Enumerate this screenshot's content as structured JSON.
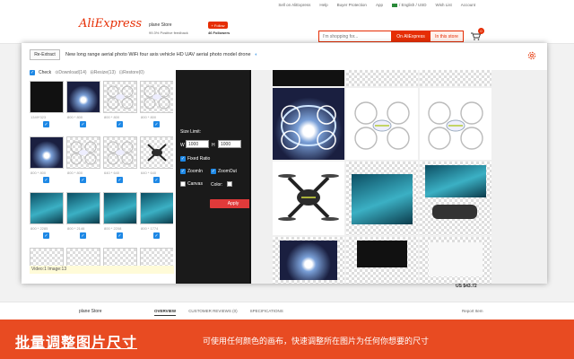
{
  "topbar": {
    "items": [
      "Sell on AliExpress",
      "Help",
      "Buyer Protection",
      "App",
      "/ English / USD",
      "Wish List",
      "Account"
    ]
  },
  "header": {
    "logo": "AliExpress",
    "store_name": "plane Store",
    "feedback": "99.3% Positive feedback",
    "follow_label": "+ Follow",
    "followers": "46 Followers",
    "search_placeholder": "I'm shopping for...",
    "search_on_ae": "On AliExpress",
    "search_in_store": "In this store",
    "cart_count": "0"
  },
  "page": {
    "price": "US $43.72",
    "store_tab": "plane Store",
    "tabs": [
      "OVERVIEW",
      "CUSTOMER REVIEWS (0)",
      "SPECIFICATIONS"
    ],
    "report_item": "Report Item"
  },
  "panel": {
    "re_extract": "Re-Extract",
    "title": "New long range aerial photo WiFi four axis vehicle HD UAV aerial photo model drone",
    "check_label": "Check",
    "download_label": "Download(14)",
    "resize_label": "Resize(13)",
    "restore_label": "Restore(0)",
    "footer_info": "Video:1 Image:13",
    "thumbs": [
      {
        "size": "1349*323",
        "style": "dark"
      },
      {
        "size": "800 * 800",
        "style": "night"
      },
      {
        "size": "800 * 800",
        "style": "drone-white"
      },
      {
        "size": "800 * 800",
        "style": "drone-white"
      },
      {
        "size": "800 * 800",
        "style": "night"
      },
      {
        "size": "800 * 800",
        "style": "drone-white"
      },
      {
        "size": "640 * 640",
        "style": "drone-white"
      },
      {
        "size": "640 * 640",
        "style": "drone-black"
      },
      {
        "size": "800 * 2285",
        "style": "teal"
      },
      {
        "size": "800 * 2146",
        "style": "teal"
      },
      {
        "size": "800 * 2208",
        "style": "teal"
      },
      {
        "size": "800 * 1774",
        "style": "teal"
      },
      {
        "size": "",
        "style": "checker"
      },
      {
        "size": "",
        "style": "checker"
      },
      {
        "size": "",
        "style": "checker"
      },
      {
        "size": "",
        "style": "checker"
      }
    ]
  },
  "resize": {
    "size_limit": "Size Limit:",
    "w_label": "W",
    "w_value": "1000",
    "h_label": "H",
    "h_value": "1000",
    "fixed_ratio": "Fixed Ratio",
    "zoom_in": "ZoomIn",
    "zoom_out": "ZoomOut",
    "canvas": "Canvas",
    "color": "Color:",
    "apply": "Apply"
  },
  "banner": {
    "title": "批量调整图片尺寸",
    "desc": "可使用任何颜色的画布，快速调整所在图片为任何你想要的尺寸"
  },
  "colors": {
    "accent": "#e62e04",
    "banner": "#e84b22",
    "check_blue": "#1e88e5",
    "apply_red": "#e03a3a"
  }
}
